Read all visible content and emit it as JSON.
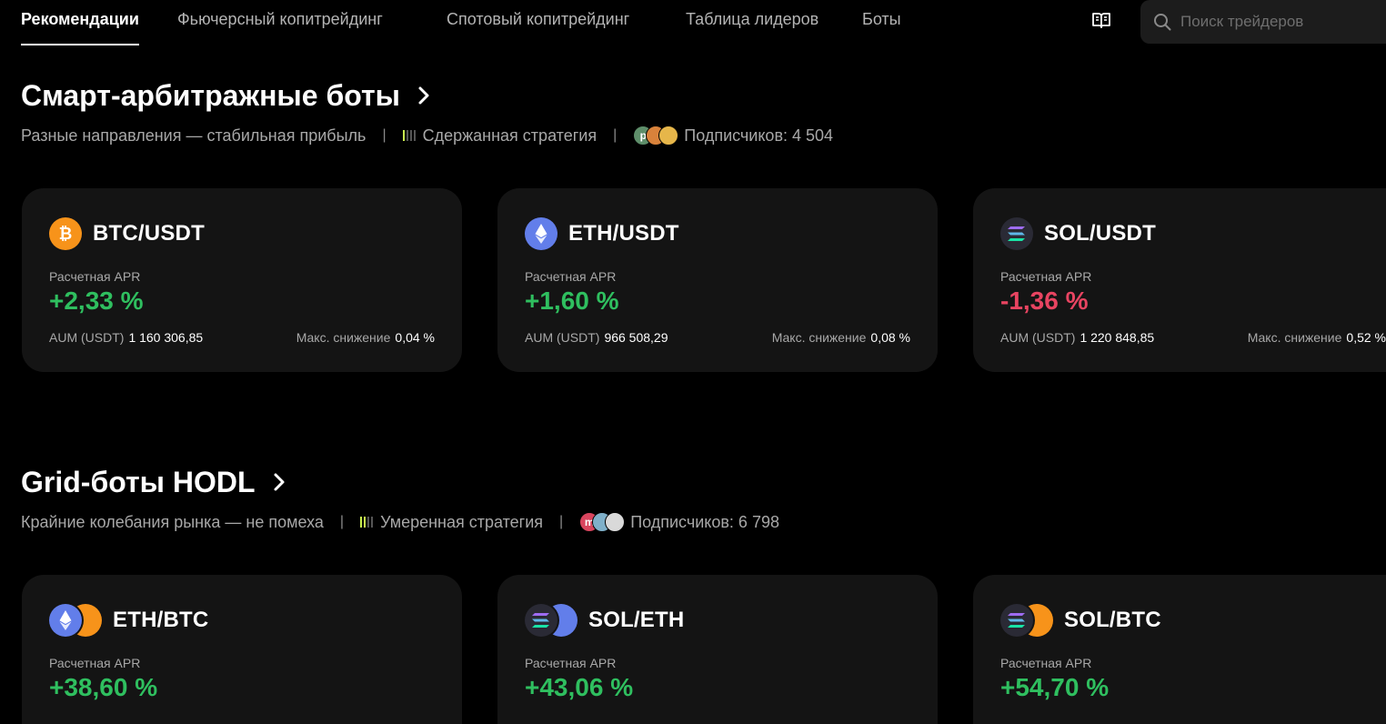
{
  "nav": {
    "tabs": [
      {
        "label": "Рекомендации",
        "active": true
      },
      {
        "label": "Фьючерсный копитрейдинг",
        "active": false
      },
      {
        "label": "Спотовый копитрейдинг",
        "active": false
      },
      {
        "label": "Таблица лидеров",
        "active": false
      },
      {
        "label": "Боты",
        "active": false
      }
    ],
    "guide_icon": "book-icon",
    "search": {
      "placeholder": "Поиск трейдеров",
      "value": "",
      "icon": "search-icon"
    }
  },
  "colors": {
    "positive": "#2fbf5f",
    "negative": "#e84461",
    "card_bg": "#141414",
    "strategy_accent": "#c9f04f"
  },
  "sections": [
    {
      "title": "Смарт-арбитражные боты",
      "description": "Разные направления — стабильная прибыль",
      "strategy": "Сдержанная стратегия",
      "strategy_level": 1,
      "subscriber_avatars": [
        "p",
        "",
        ""
      ],
      "subscribers": "Подписчиков: 4 504",
      "cards": [
        {
          "pair": "BTC/USDT",
          "coins": [
            "btc"
          ],
          "apr_label": "Расчетная APR",
          "apr": "+2,33 %",
          "trend": "positive",
          "aum_label": "AUM (USDT)",
          "aum": "1 160 306,85",
          "drawdown_label": "Макс. снижение",
          "drawdown": "0,04 %"
        },
        {
          "pair": "ETH/USDT",
          "coins": [
            "eth"
          ],
          "apr_label": "Расчетная APR",
          "apr": "+1,60 %",
          "trend": "positive",
          "aum_label": "AUM (USDT)",
          "aum": "966 508,29",
          "drawdown_label": "Макс. снижение",
          "drawdown": "0,08 %"
        },
        {
          "pair": "SOL/USDT",
          "coins": [
            "sol"
          ],
          "apr_label": "Расчетная APR",
          "apr": "-1,36 %",
          "trend": "negative",
          "aum_label": "AUM (USDT)",
          "aum": "1 220 848,85",
          "drawdown_label": "Макс. снижение",
          "drawdown": "0,52 %"
        }
      ]
    },
    {
      "title": "Grid-боты HODL",
      "description": "Крайние колебания рынка — не помеха",
      "strategy": "Умеренная стратегия",
      "strategy_level": 2,
      "subscriber_avatars": [
        "m",
        "",
        ""
      ],
      "subscribers": "Подписчиков: 6 798",
      "cards": [
        {
          "pair": "ETH/BTC",
          "coins": [
            "eth",
            "btc"
          ],
          "apr_label": "Расчетная APR",
          "apr": "+38,60 %",
          "trend": "positive"
        },
        {
          "pair": "SOL/ETH",
          "coins": [
            "sol",
            "eth"
          ],
          "apr_label": "Расчетная APR",
          "apr": "+43,06 %",
          "trend": "positive"
        },
        {
          "pair": "SOL/BTC",
          "coins": [
            "sol",
            "btc"
          ],
          "apr_label": "Расчетная APR",
          "apr": "+54,70 %",
          "trend": "positive"
        }
      ]
    }
  ]
}
